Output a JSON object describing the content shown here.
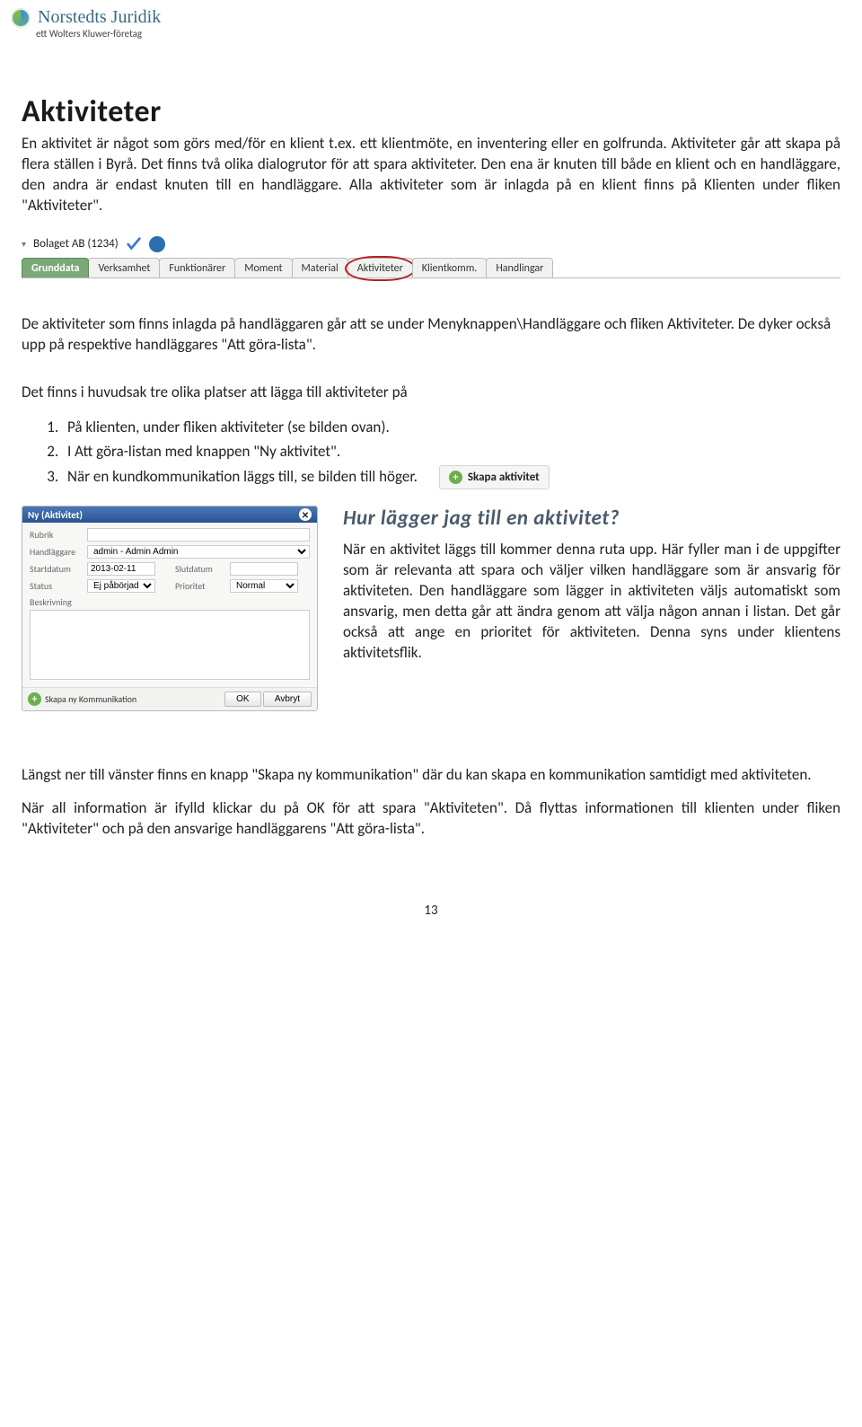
{
  "logo": {
    "name": "Norstedts Juridik",
    "sub": "ett Wolters Kluwer-företag"
  },
  "title": "Aktiviteter",
  "intro": "En aktivitet är något som görs med/för en klient t.ex. ett klientmöte, en inventering eller en golfrunda. Aktiviteter går att skapa på flera ställen i Byrå. Det finns två olika dialogrutor för att spara aktiviteter. Den ena är knuten till både en klient och en handläggare, den andra är endast knuten till en handläggare. Alla aktiviteter som är inlagda på en klient finns på Klienten under fliken \"Aktiviteter\".",
  "tabs_header": {
    "client": "Bolaget AB (1234)"
  },
  "tabs": [
    {
      "label": "Grunddata",
      "active": true
    },
    {
      "label": "Verksamhet"
    },
    {
      "label": "Funktionärer"
    },
    {
      "label": "Moment"
    },
    {
      "label": "Material"
    },
    {
      "label": "Aktiviteter",
      "circled": true
    },
    {
      "label": "Klientkomm."
    },
    {
      "label": "Handlingar"
    }
  ],
  "para2": "De aktiviteter som finns inlagda på handläggaren går att se under Menyknappen\\Handläggare och fliken Aktiviteter. De dyker också upp på respektive handläggares \"Att göra-lista\".",
  "list_heading": "Det finns i huvudsak tre olika platser att lägga till aktiviteter på",
  "list": [
    "På klienten, under fliken aktiviteter (se bilden ovan).",
    "I Att göra-listan med knappen \"Ny aktivitet\".",
    "När en kundkommunikation läggs till, se bilden till höger."
  ],
  "skapa_btn": "Skapa aktivitet",
  "dialog": {
    "title": "Ny (Aktivitet)",
    "labels": {
      "rubrik": "Rubrik",
      "handlaggare": "Handläggare",
      "startdatum": "Startdatum",
      "slutdatum": "Slutdatum",
      "status": "Status",
      "prioritet": "Prioritet",
      "beskrivning": "Beskrivning"
    },
    "values": {
      "handlaggare": "admin - Admin Admin",
      "startdatum": "2013-02-11",
      "status": "Ej påbörjad",
      "prioritet": "Normal"
    },
    "footer_link": "Skapa ny Kommunikation",
    "ok": "OK",
    "cancel": "Avbryt"
  },
  "howto_title": "Hur lägger jag till en aktivitet?",
  "howto_text": "När en aktivitet läggs till kommer denna ruta upp. Här fyller man i de uppgifter som är relevanta att spara och väljer vilken handläggare som är ansvarig för aktiviteten. Den handläggare som lägger in aktiviteten väljs automatiskt som ansvarig, men detta går att ändra genom att välja någon annan i listan. Det går också att ange en prioritet för aktiviteten. Denna syns under klientens aktivitetsflik.",
  "para3": "Längst ner till vänster finns en knapp \"Skapa ny kommunikation\" där du kan skapa en kommunikation samtidigt med aktiviteten.",
  "para4": "När all information är ifylld klickar du på OK för att spara \"Aktiviteten\". Då flyttas informationen till klienten under fliken \"Aktiviteter\" och på den ansvarige handläggarens \"Att göra-lista\".",
  "page_number": "13"
}
